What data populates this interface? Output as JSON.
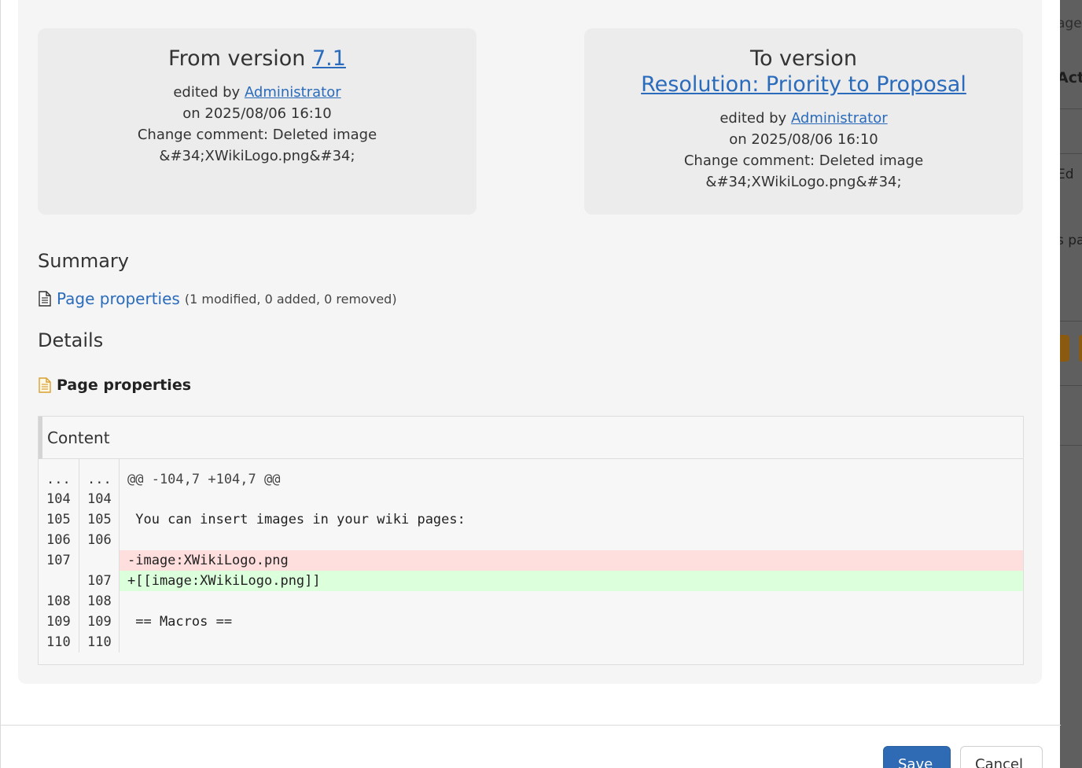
{
  "background": {
    "fragments": [
      "age",
      "Acti",
      "Ed",
      "s pa"
    ]
  },
  "from_version": {
    "heading_prefix": "From version",
    "version": "7.1",
    "edited_by_label": "edited by",
    "author": "Administrator",
    "date": "on 2025/08/06 16:10",
    "comment_line1": "Change comment: Deleted image",
    "comment_line2": "&#34;XWikiLogo.png&#34;"
  },
  "to_version": {
    "heading_prefix": "To version",
    "version": "Resolution: Priority to Proposal",
    "edited_by_label": "edited by",
    "author": "Administrator",
    "date": "on 2025/08/06 16:10",
    "comment_line1": "Change comment: Deleted image",
    "comment_line2": "&#34;XWikiLogo.png&#34;"
  },
  "summary": {
    "title": "Summary",
    "link": "Page properties",
    "counts": "(1 modified, 0 added, 0 removed)"
  },
  "details": {
    "title": "Details",
    "section": "Page properties",
    "diff_label": "Content",
    "rows": [
      {
        "old": "...",
        "new": "...",
        "code": "@@ -104,7 +104,7 @@",
        "type": "hunk"
      },
      {
        "old": "104",
        "new": "104",
        "code": "",
        "type": "ctx"
      },
      {
        "old": "105",
        "new": "105",
        "code": " You can insert images in your wiki pages:",
        "type": "ctx"
      },
      {
        "old": "106",
        "new": "106",
        "code": "",
        "type": "ctx"
      },
      {
        "old": "107",
        "new": "",
        "code": "-image:XWikiLogo.png",
        "type": "del"
      },
      {
        "old": "",
        "new": "107",
        "code": "+[[image:XWikiLogo.png]]",
        "type": "ins"
      },
      {
        "old": "108",
        "new": "108",
        "code": "",
        "type": "ctx"
      },
      {
        "old": "109",
        "new": "109",
        "code": " == Macros ==",
        "type": "ctx"
      },
      {
        "old": "110",
        "new": "110",
        "code": "",
        "type": "ctx"
      }
    ]
  },
  "footer": {
    "save_label": "Save",
    "cancel_label": "Cancel"
  },
  "colors": {
    "link": "#2a6bbc",
    "deleted_bg": "#ffdede",
    "inserted_bg": "#dcffdc",
    "primary_button": "#2f6bb5"
  }
}
